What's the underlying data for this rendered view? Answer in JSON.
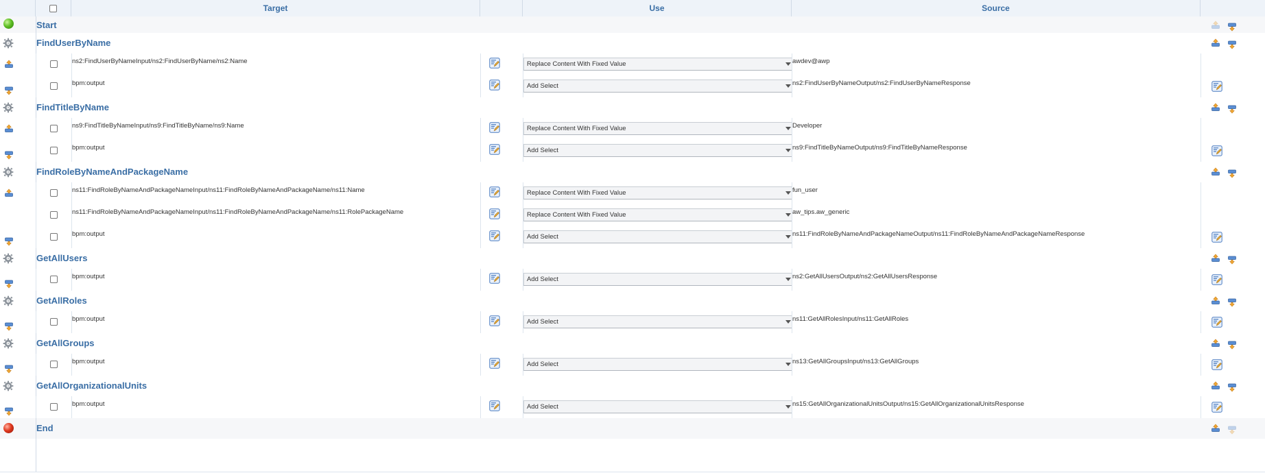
{
  "header": {
    "target": "Target",
    "use": "Use",
    "source": "Source"
  },
  "start": {
    "label": "Start"
  },
  "end": {
    "label": "End"
  },
  "steps": [
    {
      "name": "FindUserByName",
      "rows": [
        {
          "direction": "input",
          "target": "ns2:FindUserByNameInput/ns2:FindUserByName/ns2:Name",
          "use": "Replace Content With Fixed Value",
          "source": "awdev@awp"
        },
        {
          "direction": "output",
          "target": "bpm:output",
          "use": "Add Select",
          "source": "ns2:FindUserByNameOutput/ns2:FindUserByNameResponse"
        }
      ]
    },
    {
      "name": "FindTitleByName",
      "rows": [
        {
          "direction": "input",
          "target": "ns9:FindTitleByNameInput/ns9:FindTitleByName/ns9:Name",
          "use": "Replace Content With Fixed Value",
          "source": "Developer"
        },
        {
          "direction": "output",
          "target": "bpm:output",
          "use": "Add Select",
          "source": "ns9:FindTitleByNameOutput/ns9:FindTitleByNameResponse"
        }
      ]
    },
    {
      "name": "FindRoleByNameAndPackageName",
      "rows": [
        {
          "direction": "input",
          "target": "ns11:FindRoleByNameAndPackageNameInput/ns11:FindRoleByNameAndPackageName/ns11:Name",
          "use": "Replace Content With Fixed Value",
          "source": "fun_user"
        },
        {
          "direction": "none",
          "target": "ns11:FindRoleByNameAndPackageNameInput/ns11:FindRoleByNameAndPackageName/ns11:RolePackageName",
          "use": "Replace Content With Fixed Value",
          "source": "aw_tips.aw_generic"
        },
        {
          "direction": "output",
          "target": "bpm:output",
          "use": "Add Select",
          "source": "ns11:FindRoleByNameAndPackageNameOutput/ns11:FindRoleByNameAndPackageNameResponse"
        }
      ]
    },
    {
      "name": "GetAllUsers",
      "rows": [
        {
          "direction": "output",
          "target": "bpm:output",
          "use": "Add Select",
          "source": "ns2:GetAllUsersOutput/ns2:GetAllUsersResponse"
        }
      ]
    },
    {
      "name": "GetAllRoles",
      "rows": [
        {
          "direction": "output",
          "target": "bpm:output",
          "use": "Add Select",
          "source": "ns11:GetAllRolesInput/ns11:GetAllRoles"
        }
      ]
    },
    {
      "name": "GetAllGroups",
      "rows": [
        {
          "direction": "output",
          "target": "bpm:output",
          "use": "Add Select",
          "source": "ns13:GetAllGroupsInput/ns13:GetAllGroups"
        }
      ]
    },
    {
      "name": "GetAllOrganizationalUnits",
      "rows": [
        {
          "direction": "output",
          "target": "bpm:output",
          "use": "Add Select",
          "source": "ns15:GetAllOrganizationalUnitsOutput/ns15:GetAllOrganizationalUnitsResponse"
        }
      ]
    }
  ],
  "icons": {
    "step": "gear-icon",
    "input_map": "input-arrow-icon",
    "output_map": "output-arrow-icon",
    "edit": "edit-expression-icon",
    "move_up": "move-up-icon",
    "move_down": "move-down-icon"
  },
  "colors": {
    "header_text": "#3a6ea5",
    "step_text": "#3a6ea5",
    "start_dot": "#4caf1f",
    "end_dot": "#d8321a"
  }
}
